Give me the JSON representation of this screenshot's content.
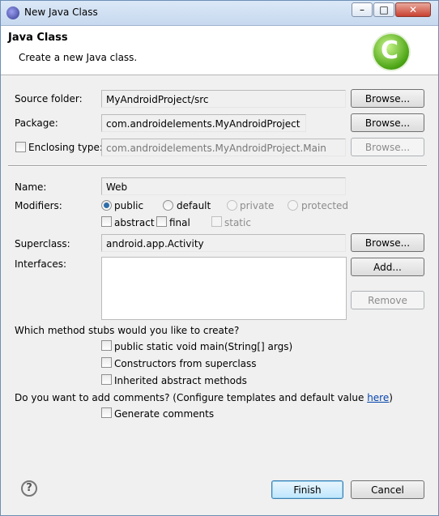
{
  "window": {
    "title": "New Java Class",
    "controls": {
      "minimize": "–",
      "maximize": "□",
      "close": "✕"
    }
  },
  "header": {
    "title": "Java Class",
    "description": "Create a new Java class.",
    "logo_icon": "java-class-c-icon"
  },
  "source_folder": {
    "label": "Source folder:",
    "value": "MyAndroidProject/src",
    "button": "Browse..."
  },
  "package": {
    "label": "Package:",
    "value": "com.androidelements.MyAndroidProject",
    "button": "Browse..."
  },
  "enclosing_type": {
    "label": "Enclosing type:",
    "checked": false,
    "value": "com.androidelements.MyAndroidProject.Main",
    "button": "Browse..."
  },
  "name": {
    "label": "Name:",
    "value": "Web"
  },
  "modifiers": {
    "label": "Modifiers:",
    "access": [
      {
        "label": "public",
        "selected": true,
        "enabled": true
      },
      {
        "label": "default",
        "selected": false,
        "enabled": true
      },
      {
        "label": "private",
        "selected": false,
        "enabled": false
      },
      {
        "label": "protected",
        "selected": false,
        "enabled": false
      }
    ],
    "flags": [
      {
        "label": "abstract",
        "checked": false,
        "enabled": true
      },
      {
        "label": "final",
        "checked": false,
        "enabled": true
      },
      {
        "label": "static",
        "checked": false,
        "enabled": false
      }
    ]
  },
  "superclass": {
    "label": "Superclass:",
    "value": "android.app.Activity",
    "button": "Browse..."
  },
  "interfaces": {
    "label": "Interfaces:",
    "add_button": "Add...",
    "remove_button": "Remove"
  },
  "stubs": {
    "question": "Which method stubs would you like to create?",
    "options": [
      {
        "label": "public static void main(String[] args)",
        "checked": false
      },
      {
        "label": "Constructors from superclass",
        "checked": false
      },
      {
        "label": "Inherited abstract methods",
        "checked": false
      }
    ]
  },
  "comments": {
    "question": "Do you want to add comments? (Configure templates and default value ",
    "link": "here",
    "question_end": ")",
    "option": "Generate comments"
  },
  "footer": {
    "help": "?",
    "finish": "Finish",
    "cancel": "Cancel"
  }
}
